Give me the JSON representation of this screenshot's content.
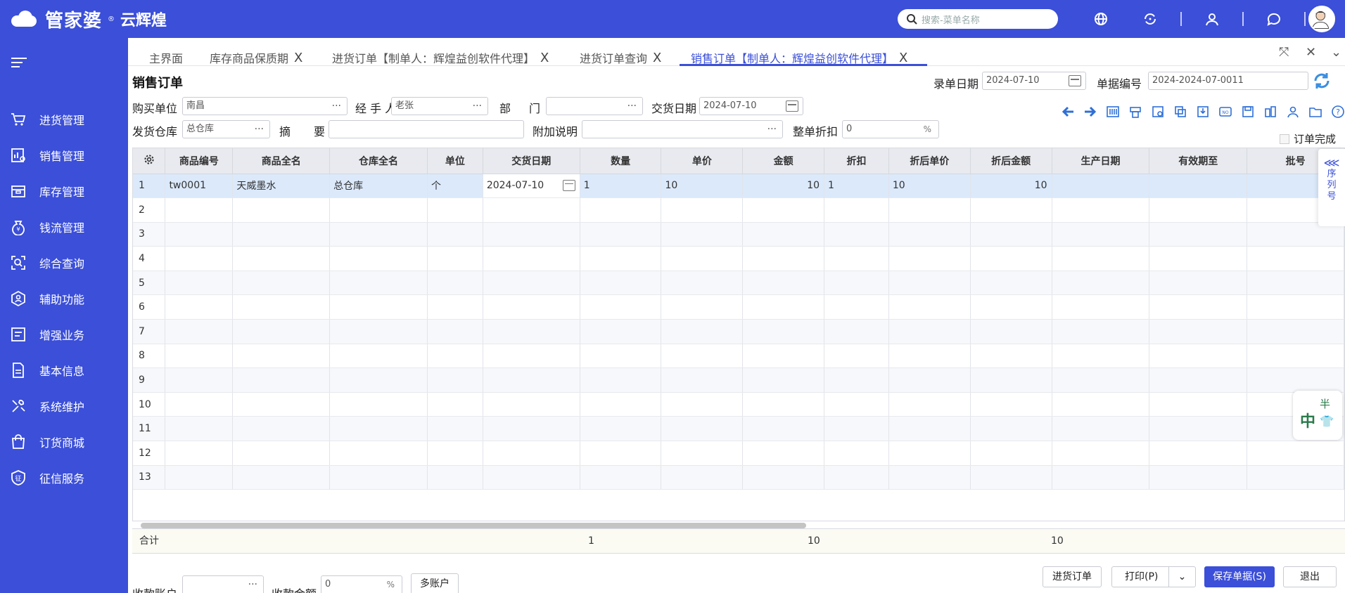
{
  "app": {
    "logo_text": "管家婆",
    "logo_reg": "®",
    "logo_sub": "云辉煌"
  },
  "search": {
    "placeholder": "搜索-菜单名称"
  },
  "sidebar": {
    "items": [
      {
        "label": "进货管理",
        "icon": "cart-icon"
      },
      {
        "label": "销售管理",
        "icon": "sales-chart-icon"
      },
      {
        "label": "库存管理",
        "icon": "warehouse-box-icon"
      },
      {
        "label": "钱流管理",
        "icon": "money-bag-icon"
      },
      {
        "label": "综合查询",
        "icon": "search-scan-icon"
      },
      {
        "label": "辅助功能",
        "icon": "hexagon-helper-icon"
      },
      {
        "label": "增强业务",
        "icon": "enhance-list-icon"
      },
      {
        "label": "基本信息",
        "icon": "document-icon"
      },
      {
        "label": "系统维护",
        "icon": "tools-icon"
      },
      {
        "label": "订货商城",
        "icon": "shop-bag-icon"
      },
      {
        "label": "征信服务",
        "icon": "credit-badge-icon"
      }
    ]
  },
  "tabs": [
    {
      "label": "主界面",
      "closable": false
    },
    {
      "label": "库存商品保质期",
      "closable": true
    },
    {
      "label": "进货订单【制单人：辉煌益创软件代理】",
      "closable": true
    },
    {
      "label": "进货订单查询",
      "closable": true
    },
    {
      "label": "销售订单【制单人：辉煌益创软件代理】",
      "closable": true,
      "active": true
    }
  ],
  "close_glyph": "X",
  "form": {
    "title": "销售订单",
    "entry_date_label": "录单日期",
    "entry_date": "2024-07-10",
    "doc_no_label": "单据编号",
    "doc_no": "2024-2024-07-0011",
    "buyer_label": "购买单位",
    "buyer": "南昌",
    "handler_label": "经 手 人",
    "handler": "老张",
    "dept_label_1": "部",
    "dept_label_2": "门",
    "dept": "",
    "delivery_date_label": "交货日期",
    "delivery_date": "2024-07-10",
    "warehouse_label": "发货仓库",
    "warehouse": "总仓库",
    "summary_label_1": "摘",
    "summary_label_2": "要",
    "summary": "",
    "extra_label": "附加说明",
    "extra": "",
    "discount_label": "整单折扣",
    "discount": "0",
    "order_complete_label": "订单完成",
    "dots": "···",
    "pct": "%"
  },
  "grid": {
    "columns": [
      "商品编号",
      "商品全名",
      "仓库全名",
      "单位",
      "交货日期",
      "数量",
      "单价",
      "金额",
      "折扣",
      "折后单价",
      "折后金额",
      "生产日期",
      "有效期至",
      "批号"
    ],
    "rows": [
      {
        "n": "1",
        "code": "tw0001",
        "name": "天威墨水",
        "wh": "总仓库",
        "unit": "个",
        "date": "2024-07-10",
        "qty": "1",
        "price": "10",
        "amount": "10",
        "disc": "1",
        "dprice": "10",
        "damount": "10"
      },
      {
        "n": "2"
      },
      {
        "n": "3"
      },
      {
        "n": "4"
      },
      {
        "n": "5"
      },
      {
        "n": "6"
      },
      {
        "n": "7"
      },
      {
        "n": "8"
      },
      {
        "n": "9"
      },
      {
        "n": "10"
      },
      {
        "n": "11"
      },
      {
        "n": "12"
      },
      {
        "n": "13"
      }
    ],
    "totals": {
      "label": "合计",
      "qty": "1",
      "amount": "10",
      "damount": "10"
    }
  },
  "side_tab": {
    "lines": [
      "序",
      "列",
      "号"
    ]
  },
  "ime": {
    "char1": "中",
    "char2": "半"
  },
  "footer": {
    "account_label": "收款账户",
    "account": "",
    "amount_label": "收款金额",
    "amount": "0",
    "multi_btn": "多账户",
    "purchase_btn": "进货订单",
    "print_btn": "打印(P)",
    "save_btn": "保存单据(S)",
    "exit_btn": "退出"
  }
}
